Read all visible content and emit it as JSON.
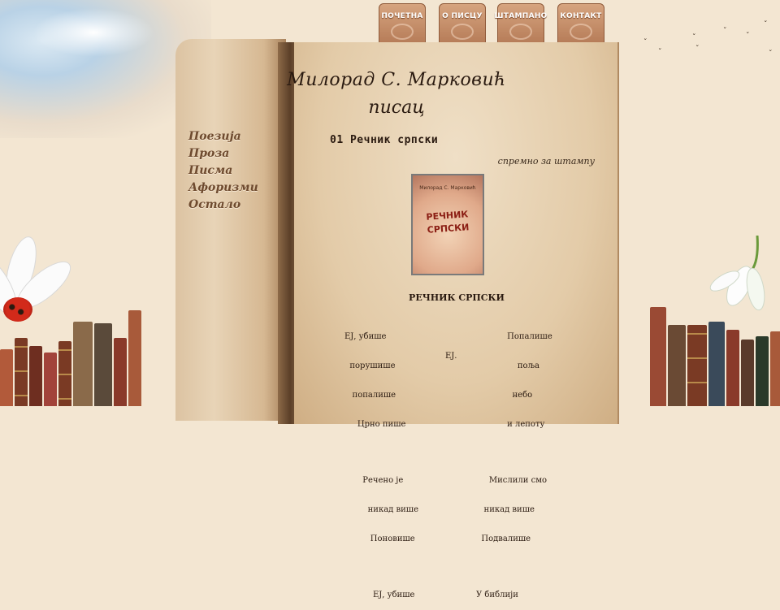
{
  "top_nav": [
    {
      "label": "ПОЧЕТНА"
    },
    {
      "label": "О ПИСЦУ"
    },
    {
      "label": "ШТАМПАНО"
    },
    {
      "label": "КОНТАКТ"
    }
  ],
  "header": {
    "author": "Милорад  С. Марковић",
    "role": "писац"
  },
  "side_nav": [
    {
      "label": "Поезија"
    },
    {
      "label": "Проза"
    },
    {
      "label": "Писма"
    },
    {
      "label": "Афоризми"
    },
    {
      "label": "Остало"
    }
  ],
  "main": {
    "heading": "01 Речник српски",
    "status": "спремно за штампу",
    "cover": {
      "author": "Милорад С. Марковић",
      "title_line1": "РЕЧНИК",
      "title_line2": "СРПСКИ"
    },
    "book_title": "РЕЧНИК СРПСКИ",
    "poem_left": [
      "ЕЈ, убише",
      "  порушише",
      "   попалише",
      "     Црно пише",
      "",
      "       Речено је",
      "         никад више",
      "          Поновише",
      "",
      "           ЕЈ, убише"
    ],
    "poem_middle": [
      "",
      "ЕЈ."
    ],
    "poem_right": [
      "            Попалише",
      "                поља",
      "              небо",
      "            и лепоту",
      "",
      "     Мислили смо",
      "   никад више",
      "  Подвалише",
      "",
      "У библији"
    ]
  },
  "colors": {
    "tab": "#c68d67",
    "page": "#e8d4b7",
    "nav_text": "#6e4a2e"
  }
}
